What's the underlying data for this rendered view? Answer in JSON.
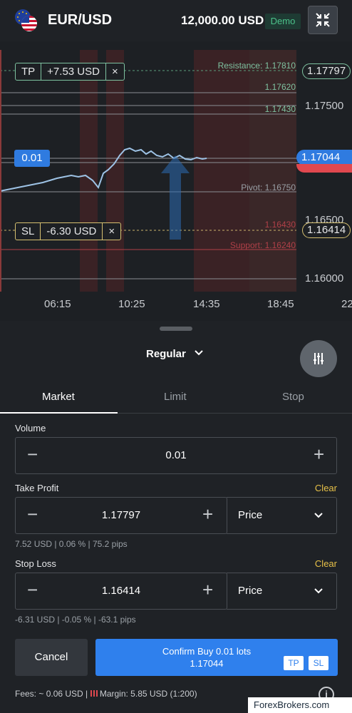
{
  "header": {
    "symbol": "EUR/USD",
    "balance": "12,000.00 USD",
    "account_badge": "Demo"
  },
  "chart": {
    "price_axis": [
      "1.17500",
      "1.16500",
      "1.16000"
    ],
    "time_axis": [
      "06:15",
      "10:25",
      "14:35",
      "18:45",
      "22"
    ],
    "tp_tag": "1.17797",
    "current_price_tag": "1.17044",
    "sl_tag": "1.16414",
    "levels": [
      {
        "label": "Resistance: 1.17810"
      },
      {
        "label": "1.17620"
      },
      {
        "label": "1.17430"
      },
      {
        "label": "Pivot: 1.16750"
      },
      {
        "label": "1.16430"
      },
      {
        "label": "Support: 1.16240"
      }
    ],
    "tp_chip": {
      "label": "TP",
      "value": "+7.53 USD",
      "close": "×"
    },
    "sl_chip": {
      "label": "SL",
      "value": "-6.30 USD",
      "close": "×"
    },
    "volume_chip": "0.01"
  },
  "order": {
    "type": "Regular",
    "tabs": [
      "Market",
      "Limit",
      "Stop"
    ],
    "volume": {
      "label": "Volume",
      "value": "0.01"
    },
    "take_profit": {
      "label": "Take Profit",
      "clear": "Clear",
      "value": "1.17797",
      "mode": "Price",
      "info": "7.52 USD | 0.06 % | 75.2 pips"
    },
    "stop_loss": {
      "label": "Stop Loss",
      "clear": "Clear",
      "value": "1.16414",
      "mode": "Price",
      "info": "-6.31 USD | -0.05 % | -63.1 pips"
    },
    "cancel": "Cancel",
    "confirm_line1": "Confirm Buy 0.01 lots",
    "confirm_line2": "1.17044",
    "confirm_tp": "TP",
    "confirm_sl": "SL",
    "fees_text": "Fees: ~ 0.06 USD | ",
    "margin_text": " Margin: 5.85 USD (1:200)",
    "watermark": "ForexBrokers.com"
  }
}
